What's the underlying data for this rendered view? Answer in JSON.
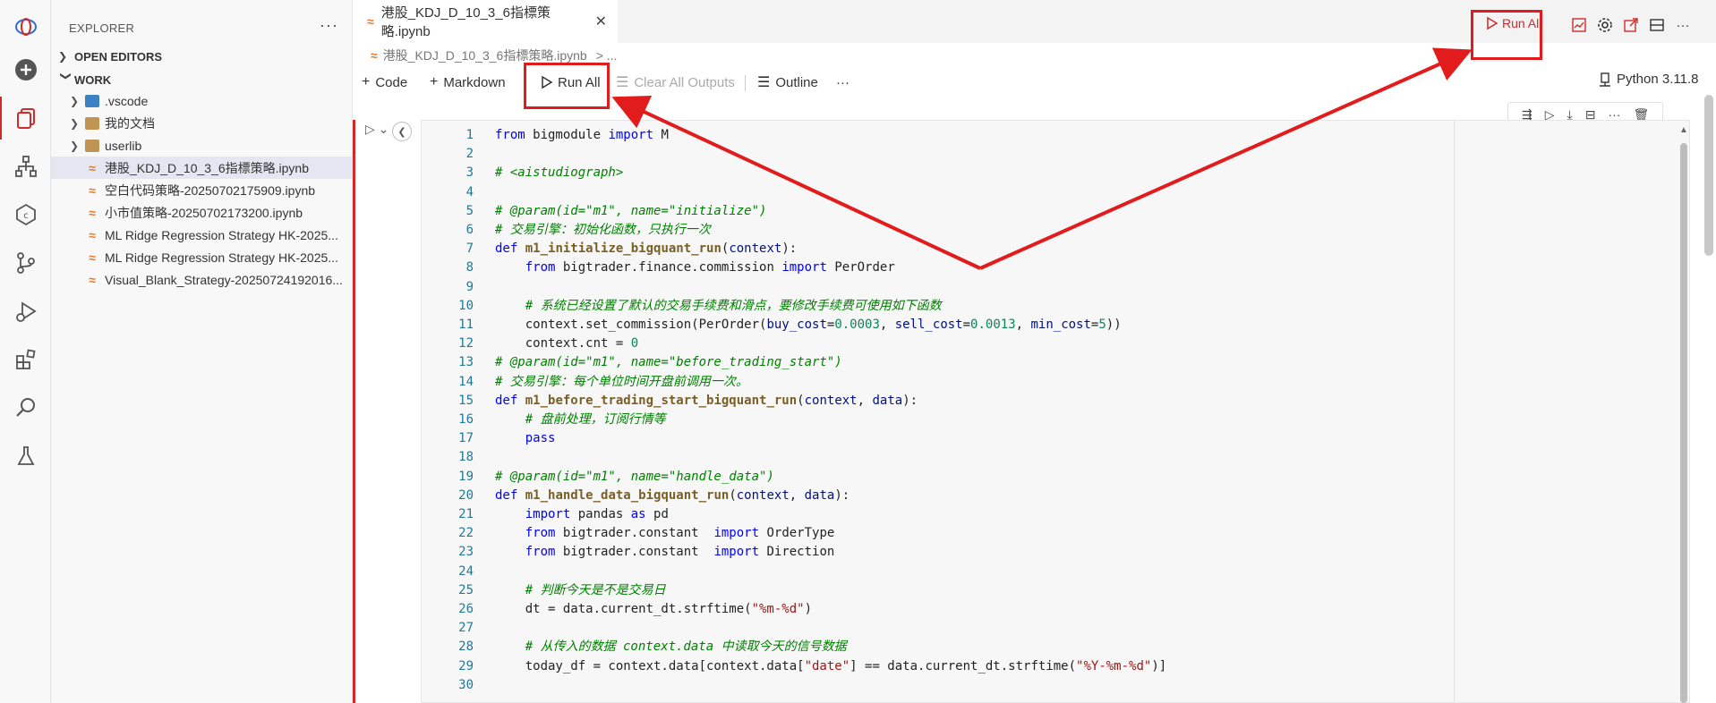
{
  "explorer": {
    "title": "EXPLORER",
    "open_editors": "OPEN EDITORS",
    "work": "WORK",
    "items": [
      {
        "label": ".vscode",
        "type": "folder-vs"
      },
      {
        "label": "我的文档",
        "type": "folder"
      },
      {
        "label": "userlib",
        "type": "folder"
      },
      {
        "label": "港股_KDJ_D_10_3_6指標策略.ipynb",
        "type": "notebook",
        "selected": true
      },
      {
        "label": "空白代码策略-20250702175909.ipynb",
        "type": "notebook"
      },
      {
        "label": "小市值策略-20250702173200.ipynb",
        "type": "notebook"
      },
      {
        "label": "ML Ridge Regression Strategy HK-2025...",
        "type": "notebook"
      },
      {
        "label": "ML Ridge Regression Strategy HK-2025...",
        "type": "notebook"
      },
      {
        "label": "Visual_Blank_Strategy-20250724192016...",
        "type": "notebook"
      }
    ]
  },
  "tab": {
    "title": "港股_KDJ_D_10_3_6指標策略.ipynb",
    "close": "✕"
  },
  "breadcrumb": {
    "file": "港股_KDJ_D_10_3_6指標策略.ipynb",
    "sep": "> ..."
  },
  "top_actions": {
    "run_all": "Run All"
  },
  "toolbar": {
    "code": "Code",
    "markdown": "Markdown",
    "run_all": "Run All",
    "clear_outputs": "Clear All Outputs",
    "outline": "Outline",
    "more": "···",
    "kernel": "Python 3.11.8"
  },
  "code_lines": [
    [
      [
        "kw",
        "from"
      ],
      [
        "t",
        " bigmodule "
      ],
      [
        "kw",
        "import"
      ],
      [
        "t",
        " M"
      ]
    ],
    [],
    [
      [
        "cm",
        "# <aistudiograph>"
      ]
    ],
    [],
    [
      [
        "cm",
        "# @param(id=\"m1\", name=\"initialize\")"
      ]
    ],
    [
      [
        "cm",
        "# 交易引擎：初始化函数，只执行一次"
      ]
    ],
    [
      [
        "kw",
        "def"
      ],
      [
        "t",
        " "
      ],
      [
        "fn",
        "m1_initialize_bigquant_run"
      ],
      [
        "t",
        "("
      ],
      [
        "p",
        "context"
      ],
      [
        "t",
        "):"
      ]
    ],
    [
      [
        "t",
        "    "
      ],
      [
        "kw",
        "from"
      ],
      [
        "t",
        " bigtrader.finance.commission "
      ],
      [
        "kw",
        "import"
      ],
      [
        "t",
        " PerOrder"
      ]
    ],
    [],
    [
      [
        "t",
        "    "
      ],
      [
        "cm",
        "# 系统已经设置了默认的交易手续费和滑点，要修改手续费可使用如下函数"
      ]
    ],
    [
      [
        "t",
        "    context.set_commission(PerOrder("
      ],
      [
        "p",
        "buy_cost"
      ],
      [
        "t",
        "="
      ],
      [
        "n",
        "0.0003"
      ],
      [
        "t",
        ", "
      ],
      [
        "p",
        "sell_cost"
      ],
      [
        "t",
        "="
      ],
      [
        "n",
        "0.0013"
      ],
      [
        "t",
        ", "
      ],
      [
        "p",
        "min_cost"
      ],
      [
        "t",
        "="
      ],
      [
        "n",
        "5"
      ],
      [
        "t",
        "))"
      ]
    ],
    [
      [
        "t",
        "    context.cnt = "
      ],
      [
        "n",
        "0"
      ]
    ],
    [
      [
        "cm",
        "# @param(id=\"m1\", name=\"before_trading_start\")"
      ]
    ],
    [
      [
        "cm",
        "# 交易引擎：每个单位时间开盘前调用一次。"
      ]
    ],
    [
      [
        "kw",
        "def"
      ],
      [
        "t",
        " "
      ],
      [
        "fn",
        "m1_before_trading_start_bigquant_run"
      ],
      [
        "t",
        "("
      ],
      [
        "p",
        "context"
      ],
      [
        "t",
        ", "
      ],
      [
        "p",
        "data"
      ],
      [
        "t",
        "):"
      ]
    ],
    [
      [
        "t",
        "    "
      ],
      [
        "cm",
        "# 盘前处理，订阅行情等"
      ]
    ],
    [
      [
        "t",
        "    "
      ],
      [
        "kw",
        "pass"
      ]
    ],
    [],
    [
      [
        "cm",
        "# @param(id=\"m1\", name=\"handle_data\")"
      ]
    ],
    [
      [
        "kw",
        "def"
      ],
      [
        "t",
        " "
      ],
      [
        "fn",
        "m1_handle_data_bigquant_run"
      ],
      [
        "t",
        "("
      ],
      [
        "p",
        "context"
      ],
      [
        "t",
        ", "
      ],
      [
        "p",
        "data"
      ],
      [
        "t",
        "):"
      ]
    ],
    [
      [
        "t",
        "    "
      ],
      [
        "kw",
        "import"
      ],
      [
        "t",
        " pandas "
      ],
      [
        "kw",
        "as"
      ],
      [
        "t",
        " pd"
      ]
    ],
    [
      [
        "t",
        "    "
      ],
      [
        "kw",
        "from"
      ],
      [
        "t",
        " bigtrader.constant  "
      ],
      [
        "kw",
        "import"
      ],
      [
        "t",
        " OrderType"
      ]
    ],
    [
      [
        "t",
        "    "
      ],
      [
        "kw",
        "from"
      ],
      [
        "t",
        " bigtrader.constant  "
      ],
      [
        "kw",
        "import"
      ],
      [
        "t",
        " Direction"
      ]
    ],
    [],
    [
      [
        "t",
        "    "
      ],
      [
        "cm",
        "# 判断今天是不是交易日"
      ]
    ],
    [
      [
        "t",
        "    dt = data.current_dt.strftime("
      ],
      [
        "s",
        "\"%m-%d\""
      ],
      [
        "t",
        ")"
      ]
    ],
    [],
    [
      [
        "t",
        "    "
      ],
      [
        "cm",
        "# 从传入的数据 context.data 中读取今天的信号数据"
      ]
    ],
    [
      [
        "t",
        "    today_df = context.data[context.data["
      ],
      [
        "s",
        "\"date\""
      ],
      [
        "t",
        "] == data.current_dt.strftime("
      ],
      [
        "s",
        "\"%Y-%m-%d\""
      ],
      [
        "t",
        ")]"
      ]
    ],
    []
  ],
  "colors": {
    "accent": "#d02b2b",
    "annotation": "#e21c1c"
  }
}
